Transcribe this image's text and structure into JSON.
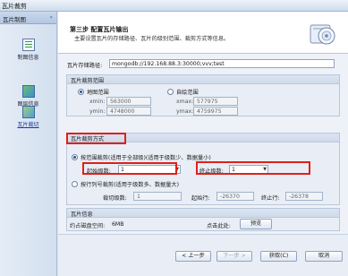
{
  "window": {
    "title": "瓦片裁剪"
  },
  "sidebar": {
    "header": "瓦片制图",
    "items": [
      {
        "label": "制图信息",
        "icon": "grid-table-icon"
      },
      {
        "label": "图层信息",
        "icon": "map-layers-icon"
      },
      {
        "label": "瓦片裁切",
        "icon": "tile-cut-icon"
      }
    ]
  },
  "header": {
    "title": "第三步 配置瓦片输出",
    "description": "主要设置瓦片的存储路径、瓦片的级别范围、裁剪方式等信息。",
    "icon": "disc-storage-icon"
  },
  "storage": {
    "label": "瓦片存储路径:",
    "value": "mongodb://192.168.88.3:30000;vvv;test"
  },
  "range": {
    "title": "瓦片裁剪范围",
    "full_label": "地图范围",
    "custom_label": "自绘范围",
    "xmin_label": "xmin:",
    "xmin": "563000",
    "xmax_label": "xmax:",
    "xmax": "577975",
    "ymin_label": "ymin:",
    "ymin": "4748000",
    "ymax_label": "ymax:",
    "ymax": "4759975"
  },
  "mode": {
    "title": "瓦片裁剪方式",
    "option_full": "按范围裁剪(适用于全部级)(适用于级数少、数据量小)",
    "start_label": "起始级数:",
    "start_value": "1",
    "end_label": "终止级数:",
    "end_value": "1",
    "option_tile": "按行列号裁剪(适用于级数多、数据量大)",
    "level_label": "裁切级数:",
    "level_value": "1",
    "row_label": "起始行:",
    "row_value": "-26370",
    "end_row_label": "终止行:",
    "end_row_value": "-26378"
  },
  "info": {
    "title": "瓦片信息",
    "space_label": "约占磁盘空间:",
    "space_value": "6MB",
    "click_label": "点击此处:",
    "preview_button": "预览"
  },
  "footer": {
    "back": "< 上一步",
    "next": "下一步 >",
    "finish": "获取(C)",
    "cancel": "取消"
  },
  "colors": {
    "highlight_box": "#e0201a",
    "link": "#1e3a9a"
  }
}
